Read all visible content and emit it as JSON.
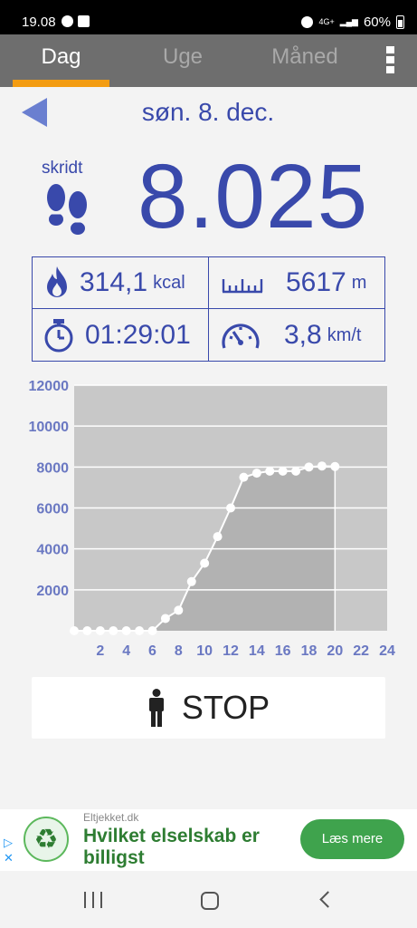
{
  "status": {
    "time": "19.08",
    "battery": "60%",
    "net": "4G+"
  },
  "tabs": [
    {
      "label": "Dag",
      "active": true
    },
    {
      "label": "Uge"
    },
    {
      "label": "Måned"
    }
  ],
  "date": "søn. 8. dec.",
  "steps": {
    "label": "skridt",
    "value": "8.025"
  },
  "stats": {
    "calories": {
      "value": "314,1",
      "unit": "kcal"
    },
    "distance": {
      "value": "5617",
      "unit": "m"
    },
    "time": {
      "value": "01:29:01"
    },
    "speed": {
      "value": "3,8",
      "unit": "km/t"
    }
  },
  "chart_data": {
    "type": "line",
    "x": [
      0,
      1,
      2,
      3,
      4,
      5,
      6,
      7,
      8,
      9,
      10,
      11,
      12,
      13,
      14,
      15,
      16,
      17,
      18,
      19,
      20
    ],
    "values": [
      0,
      0,
      0,
      0,
      0,
      0,
      0,
      600,
      1000,
      2400,
      3300,
      4600,
      6000,
      7500,
      7700,
      7800,
      7800,
      7800,
      8000,
      8050,
      8025
    ],
    "xticks": [
      "2",
      "4",
      "6",
      "8",
      "10",
      "12",
      "14",
      "16",
      "18",
      "20",
      "22",
      "24"
    ],
    "yticks": [
      "2000",
      "4000",
      "6000",
      "8000",
      "10000",
      "12000"
    ],
    "xlim": [
      0,
      24
    ],
    "ylim": [
      0,
      12000
    ],
    "grid": true,
    "colors": {
      "plot_bg": "#c8c8c8",
      "fill": "#b2b2b2",
      "line": "#ffffff",
      "tick": "#6a78c2"
    }
  },
  "stop_button": {
    "label": "STOP"
  },
  "ad": {
    "site": "Eltjekket.dk",
    "headline": "Hvilket elselskab er billigst",
    "cta": "Læs mere"
  }
}
